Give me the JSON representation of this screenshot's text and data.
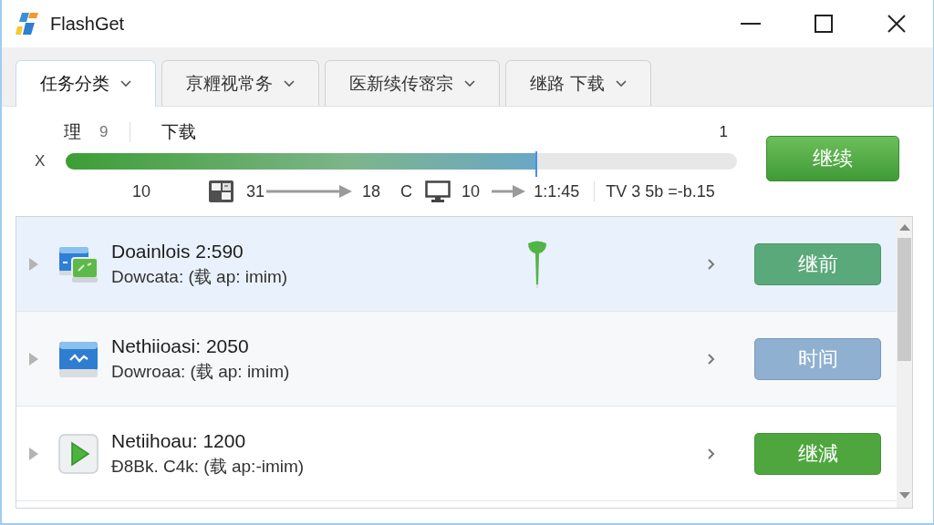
{
  "window": {
    "title": "FlashGet"
  },
  "tabs": [
    {
      "label": "任务分类",
      "selected": true
    },
    {
      "label": "亰糎视常务",
      "selected": false
    },
    {
      "label": "医新续传宻宗",
      "selected": false
    },
    {
      "label": "继路 下载",
      "selected": false
    }
  ],
  "summary": {
    "label": "理",
    "count": "9",
    "status": "下载",
    "total": "1",
    "axis_label": "X",
    "level": 0.7,
    "stats": {
      "count": "10",
      "from": "31",
      "to": "18",
      "unit": "C",
      "screen": "10",
      "time": "1:1:45",
      "extra": "TV 3 5b =-b.15"
    }
  },
  "primary_button": "继续",
  "downloads": [
    {
      "kind": "transfer",
      "title": "Doainlois 2:590",
      "detail": "Dowcata: (载 ap: imim)",
      "selected": true,
      "expanded": false,
      "pinned": true,
      "button": {
        "label": "继前",
        "color": "#5aa97a"
      }
    },
    {
      "kind": "activity",
      "title": "Nethiioasi: 2050",
      "detail": "Dowroaa: (载 ap: imim)",
      "selected": false,
      "expanded": false,
      "pinned": false,
      "button": {
        "label": "时间",
        "color": "#8fb0d0"
      }
    },
    {
      "kind": "media",
      "title": "Netiihoau: 1200",
      "detail": "Ð8Bk. C4k: (载 ap:-imim)",
      "selected": false,
      "expanded": false,
      "pinned": false,
      "button": {
        "label": "继減",
        "color": "#4fa63f"
      }
    }
  ]
}
